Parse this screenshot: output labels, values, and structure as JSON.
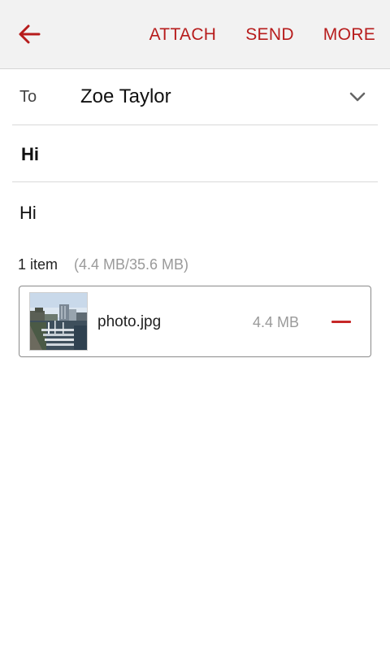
{
  "toolbar": {
    "back_icon": "arrow-left-icon",
    "attach_label": "ATTACH",
    "send_label": "SEND",
    "more_label": "MORE",
    "accent_color": "#b71c1c"
  },
  "recipient": {
    "label": "To",
    "value": "Zoe Taylor",
    "dropdown_icon": "chevron-down-icon"
  },
  "subject": "Hi",
  "body": "Hi",
  "attachments": {
    "count_label": "1 item",
    "size_label": "(4.4 MB/35.6 MB)",
    "items": [
      {
        "name": "photo.jpg",
        "size": "4.4 MB",
        "thumbnail": "photo-thumbnail",
        "remove_icon": "minus-icon"
      }
    ]
  }
}
